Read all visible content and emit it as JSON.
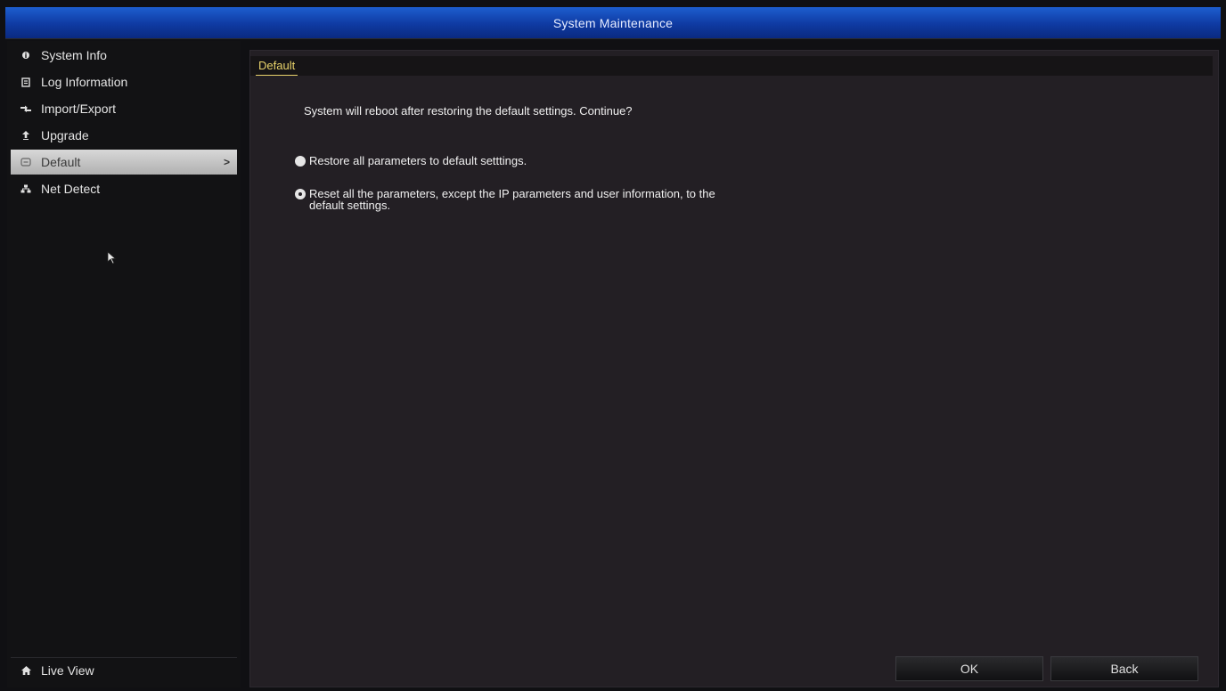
{
  "window": {
    "title": "System Maintenance"
  },
  "sidebar": {
    "items": [
      {
        "label": "System Info",
        "icon": "info-dot-icon"
      },
      {
        "label": "Log Information",
        "icon": "log-icon"
      },
      {
        "label": "Import/Export",
        "icon": "import-export-icon"
      },
      {
        "label": "Upgrade",
        "icon": "upgrade-icon"
      },
      {
        "label": "Default",
        "icon": "default-icon",
        "active": true,
        "chevron": ">"
      },
      {
        "label": "Net Detect",
        "icon": "net-detect-icon"
      }
    ],
    "live_view": {
      "label": "Live View",
      "icon": "home-icon"
    }
  },
  "content": {
    "tab": "Default",
    "prompt": "System will reboot after restoring the default settings. Continue?",
    "options": [
      {
        "label": "Restore all parameters to default setttings.",
        "selected": true
      },
      {
        "label_line1": "Reset all the parameters, except the IP parameters and user information, to the",
        "label_line2": "default settings.",
        "selected": false
      }
    ]
  },
  "buttons": {
    "ok": "OK",
    "back": "Back"
  },
  "colors": {
    "title_bar": "#1d5ecf",
    "tab_accent": "#e9d36b",
    "content_bg": "#231f24",
    "active_item": "#c8c8c8"
  }
}
